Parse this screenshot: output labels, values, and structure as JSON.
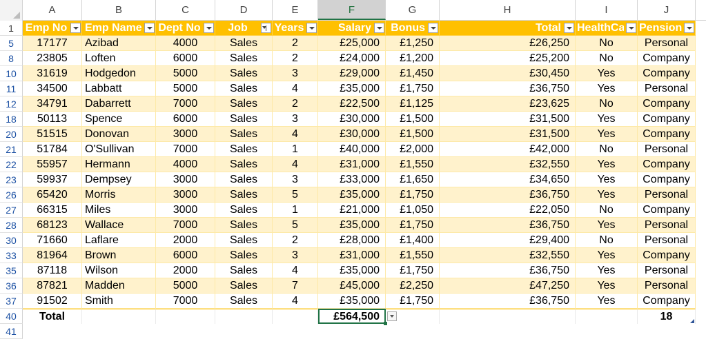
{
  "column_headers": [
    "A",
    "B",
    "C",
    "D",
    "E",
    "F",
    "G",
    "H",
    "I",
    "J"
  ],
  "header_row": {
    "row_number": "1",
    "labels": [
      "Emp No",
      "Emp Name",
      "Dept No",
      "Job",
      "Years",
      "Salary",
      "Bonus",
      "Total",
      "HealthCare",
      "Pension"
    ],
    "filtered_column": "Job"
  },
  "rows": [
    {
      "rn": "5",
      "emp_no": "17177",
      "name": "Azibad",
      "dept": "4000",
      "job": "Sales",
      "years": "2",
      "salary": "£25,000",
      "bonus": "£1,250",
      "total": "£26,250",
      "health": "No",
      "pension": "Personal"
    },
    {
      "rn": "8",
      "emp_no": "23805",
      "name": "Loften",
      "dept": "6000",
      "job": "Sales",
      "years": "2",
      "salary": "£24,000",
      "bonus": "£1,200",
      "total": "£25,200",
      "health": "No",
      "pension": "Company"
    },
    {
      "rn": "10",
      "emp_no": "31619",
      "name": "Hodgedon",
      "dept": "5000",
      "job": "Sales",
      "years": "3",
      "salary": "£29,000",
      "bonus": "£1,450",
      "total": "£30,450",
      "health": "Yes",
      "pension": "Company"
    },
    {
      "rn": "11",
      "emp_no": "34500",
      "name": "Labbatt",
      "dept": "5000",
      "job": "Sales",
      "years": "4",
      "salary": "£35,000",
      "bonus": "£1,750",
      "total": "£36,750",
      "health": "Yes",
      "pension": "Personal"
    },
    {
      "rn": "12",
      "emp_no": "34791",
      "name": "Dabarrett",
      "dept": "7000",
      "job": "Sales",
      "years": "2",
      "salary": "£22,500",
      "bonus": "£1,125",
      "total": "£23,625",
      "health": "No",
      "pension": "Company"
    },
    {
      "rn": "18",
      "emp_no": "50113",
      "name": "Spence",
      "dept": "6000",
      "job": "Sales",
      "years": "3",
      "salary": "£30,000",
      "bonus": "£1,500",
      "total": "£31,500",
      "health": "Yes",
      "pension": "Company"
    },
    {
      "rn": "20",
      "emp_no": "51515",
      "name": "Donovan",
      "dept": "3000",
      "job": "Sales",
      "years": "4",
      "salary": "£30,000",
      "bonus": "£1,500",
      "total": "£31,500",
      "health": "Yes",
      "pension": "Company"
    },
    {
      "rn": "21",
      "emp_no": "51784",
      "name": "O'Sullivan",
      "dept": "7000",
      "job": "Sales",
      "years": "1",
      "salary": "£40,000",
      "bonus": "£2,000",
      "total": "£42,000",
      "health": "No",
      "pension": "Personal"
    },
    {
      "rn": "22",
      "emp_no": "55957",
      "name": "Hermann",
      "dept": "4000",
      "job": "Sales",
      "years": "4",
      "salary": "£31,000",
      "bonus": "£1,550",
      "total": "£32,550",
      "health": "Yes",
      "pension": "Company"
    },
    {
      "rn": "23",
      "emp_no": "59937",
      "name": "Dempsey",
      "dept": "3000",
      "job": "Sales",
      "years": "3",
      "salary": "£33,000",
      "bonus": "£1,650",
      "total": "£34,650",
      "health": "Yes",
      "pension": "Company"
    },
    {
      "rn": "26",
      "emp_no": "65420",
      "name": "Morris",
      "dept": "3000",
      "job": "Sales",
      "years": "5",
      "salary": "£35,000",
      "bonus": "£1,750",
      "total": "£36,750",
      "health": "Yes",
      "pension": "Personal"
    },
    {
      "rn": "27",
      "emp_no": "66315",
      "name": "Miles",
      "dept": "3000",
      "job": "Sales",
      "years": "1",
      "salary": "£21,000",
      "bonus": "£1,050",
      "total": "£22,050",
      "health": "No",
      "pension": "Company"
    },
    {
      "rn": "28",
      "emp_no": "68123",
      "name": "Wallace",
      "dept": "7000",
      "job": "Sales",
      "years": "5",
      "salary": "£35,000",
      "bonus": "£1,750",
      "total": "£36,750",
      "health": "Yes",
      "pension": "Personal"
    },
    {
      "rn": "30",
      "emp_no": "71660",
      "name": "Laflare",
      "dept": "2000",
      "job": "Sales",
      "years": "2",
      "salary": "£28,000",
      "bonus": "£1,400",
      "total": "£29,400",
      "health": "No",
      "pension": "Personal"
    },
    {
      "rn": "33",
      "emp_no": "81964",
      "name": "Brown",
      "dept": "6000",
      "job": "Sales",
      "years": "3",
      "salary": "£31,000",
      "bonus": "£1,550",
      "total": "£32,550",
      "health": "Yes",
      "pension": "Company"
    },
    {
      "rn": "35",
      "emp_no": "87118",
      "name": "Wilson",
      "dept": "2000",
      "job": "Sales",
      "years": "4",
      "salary": "£35,000",
      "bonus": "£1,750",
      "total": "£36,750",
      "health": "Yes",
      "pension": "Personal"
    },
    {
      "rn": "36",
      "emp_no": "87821",
      "name": "Madden",
      "dept": "5000",
      "job": "Sales",
      "years": "7",
      "salary": "£45,000",
      "bonus": "£2,250",
      "total": "£47,250",
      "health": "Yes",
      "pension": "Personal"
    },
    {
      "rn": "37",
      "emp_no": "91502",
      "name": "Smith",
      "dept": "7000",
      "job": "Sales",
      "years": "4",
      "salary": "£35,000",
      "bonus": "£1,750",
      "total": "£36,750",
      "health": "Yes",
      "pension": "Company"
    }
  ],
  "total_row": {
    "rn": "40",
    "label": "Total",
    "salary_total": "£564,500",
    "pension_count": "18"
  },
  "next_row": {
    "rn": "41"
  },
  "selected_column": "F",
  "colors": {
    "header_bg": "#ffc000",
    "band_bg": "#fff2cc",
    "selection": "#217346",
    "row_number_text": "#1a4fa3"
  }
}
